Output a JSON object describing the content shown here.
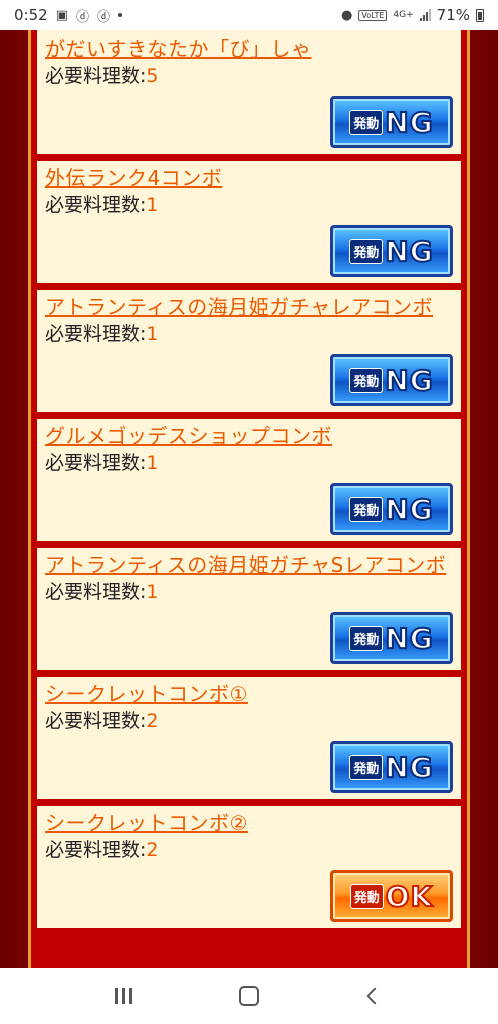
{
  "status_bar": {
    "time": "0:52",
    "network_label": "4G+",
    "volte_label": "VoLTE",
    "battery_percent": "71%"
  },
  "entries": [
    {
      "title": "がだいすきなたか「び」しゃ",
      "req_label": "必要料理数:",
      "req_value": "5",
      "button_kanji": "発動",
      "button_status": "NG"
    },
    {
      "title": "外伝ランク4コンボ",
      "req_label": "必要料理数:",
      "req_value": "1",
      "button_kanji": "発動",
      "button_status": "NG"
    },
    {
      "title": "アトランティスの海月姫ガチャレアコンボ",
      "req_label": "必要料理数:",
      "req_value": "1",
      "button_kanji": "発動",
      "button_status": "NG"
    },
    {
      "title": "グルメゴッデスショップコンボ",
      "req_label": "必要料理数:",
      "req_value": "1",
      "button_kanji": "発動",
      "button_status": "NG"
    },
    {
      "title": "アトランティスの海月姫ガチャSレアコンボ",
      "req_label": "必要料理数:",
      "req_value": "1",
      "button_kanji": "発動",
      "button_status": "NG"
    },
    {
      "title": "シークレットコンボ①",
      "req_label": "必要料理数:",
      "req_value": "2",
      "button_kanji": "発動",
      "button_status": "NG"
    },
    {
      "title": "シークレットコンボ②",
      "req_label": "必要料理数:",
      "req_value": "2",
      "button_kanji": "発動",
      "button_status": "OK"
    }
  ],
  "colors": {
    "link": "#ea5a00",
    "card_bg": "#fff5d8",
    "frame_red": "#c00000",
    "page_bg": "#7a0000",
    "gold_border": "#e0a52a",
    "ng_blue": "#1b74e6",
    "ok_orange": "#ff6a00"
  },
  "icons": {
    "status_left": [
      "gallery-icon",
      "docomo-d-icon",
      "docomo-d-icon",
      "dot-icon"
    ],
    "status_right": [
      "location-icon",
      "volte-icon",
      "network-4g-icon",
      "signal-icon",
      "battery-icon"
    ],
    "nav": [
      "recent-apps-icon",
      "home-icon",
      "back-icon"
    ]
  }
}
